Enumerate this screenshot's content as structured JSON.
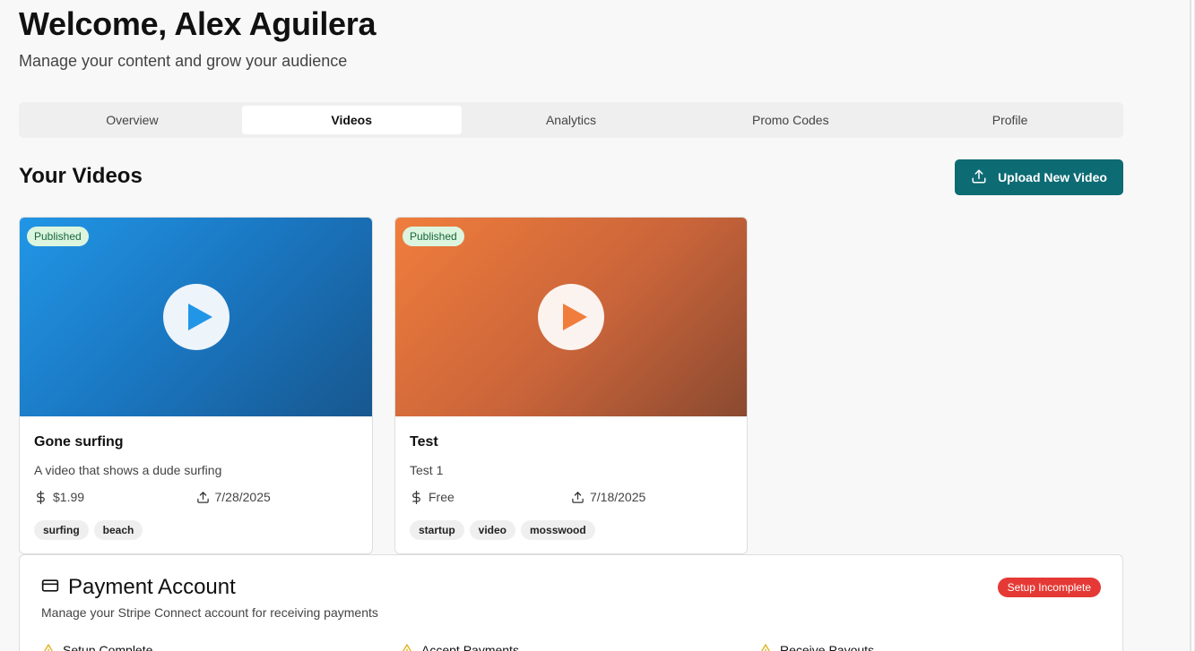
{
  "header": {
    "title": "Welcome, Alex Aguilera",
    "subtitle": "Manage your content and grow your audience"
  },
  "tabs": [
    {
      "label": "Overview",
      "active": false
    },
    {
      "label": "Videos",
      "active": true
    },
    {
      "label": "Analytics",
      "active": false
    },
    {
      "label": "Promo Codes",
      "active": false
    },
    {
      "label": "Profile",
      "active": false
    }
  ],
  "videos_section": {
    "title": "Your Videos",
    "upload_label": "Upload New Video"
  },
  "videos": [
    {
      "status": "Published",
      "title": "Gone surfing",
      "description": "A video that shows a dude surfing",
      "price": "$1.99",
      "date": "7/28/2025",
      "tags": [
        "surfing",
        "beach"
      ],
      "accent": "#2196e6"
    },
    {
      "status": "Published",
      "title": "Test",
      "description": "Test 1",
      "price": "Free",
      "date": "7/18/2025",
      "tags": [
        "startup",
        "video",
        "mosswood"
      ],
      "accent": "#f07d3c"
    }
  ],
  "payment": {
    "title": "Payment Account",
    "description": "Manage your Stripe Connect account for receiving payments",
    "badge": "Setup Incomplete",
    "statuses": [
      "Setup Complete",
      "Accept Payments",
      "Receive Payouts"
    ]
  },
  "colors": {
    "primary": "#0d6b73",
    "published_bg": "#dcf5de",
    "danger": "#e53935",
    "warning": "#e0b21a"
  }
}
